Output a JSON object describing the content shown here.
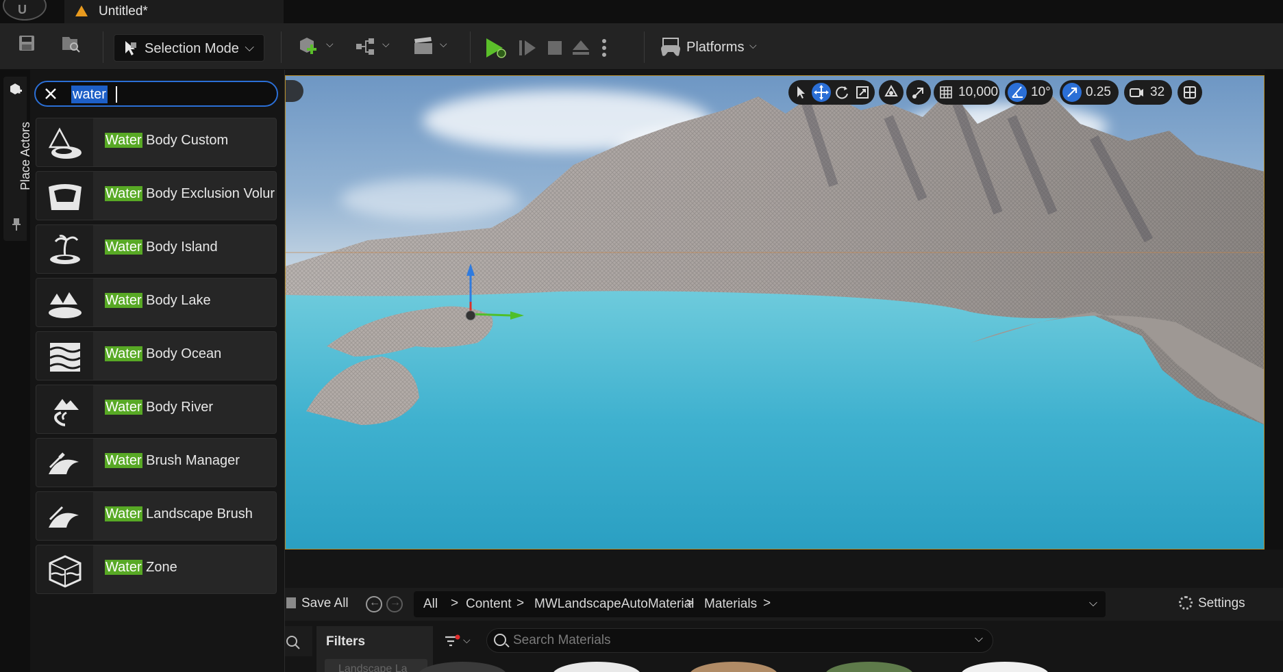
{
  "window": {
    "document_tab": "Untitled*"
  },
  "toolbar": {
    "mode_label": "Selection Mode",
    "platforms_label": "Platforms"
  },
  "side_tab": {
    "label": "Place Actors"
  },
  "place_actors": {
    "search_value": "water",
    "results": [
      {
        "highlight": "Water",
        "rest": " Body Custom",
        "icon": "water-body-custom-icon"
      },
      {
        "highlight": "Water",
        "rest": " Body Exclusion Volur",
        "icon": "water-body-exclusion-volume-icon"
      },
      {
        "highlight": "Water",
        "rest": " Body Island",
        "icon": "water-body-island-icon"
      },
      {
        "highlight": "Water",
        "rest": " Body Lake",
        "icon": "water-body-lake-icon"
      },
      {
        "highlight": "Water",
        "rest": " Body Ocean",
        "icon": "water-body-ocean-icon"
      },
      {
        "highlight": "Water",
        "rest": " Body River",
        "icon": "water-body-river-icon"
      },
      {
        "highlight": "Water",
        "rest": " Brush Manager",
        "icon": "water-brush-manager-icon"
      },
      {
        "highlight": "Water",
        "rest": " Landscape Brush",
        "icon": "water-landscape-brush-icon"
      },
      {
        "highlight": "Water",
        "rest": " Zone",
        "icon": "water-zone-icon"
      }
    ],
    "highlight_color": "#58a925"
  },
  "viewport": {
    "grid_snap": "10,000",
    "rotation_snap": "10°",
    "scale_snap": "0.25",
    "camera_speed": "32",
    "accent_color": "#2b6fd6"
  },
  "content_browser": {
    "save_all": "Save All",
    "breadcrumb": [
      "All",
      "Content",
      "MWLandscapeAutoMaterial",
      "Materials"
    ],
    "settings": "Settings",
    "filters_label": "Filters",
    "filters_item": "Landscape La",
    "search_placeholder": "Search Materials"
  }
}
